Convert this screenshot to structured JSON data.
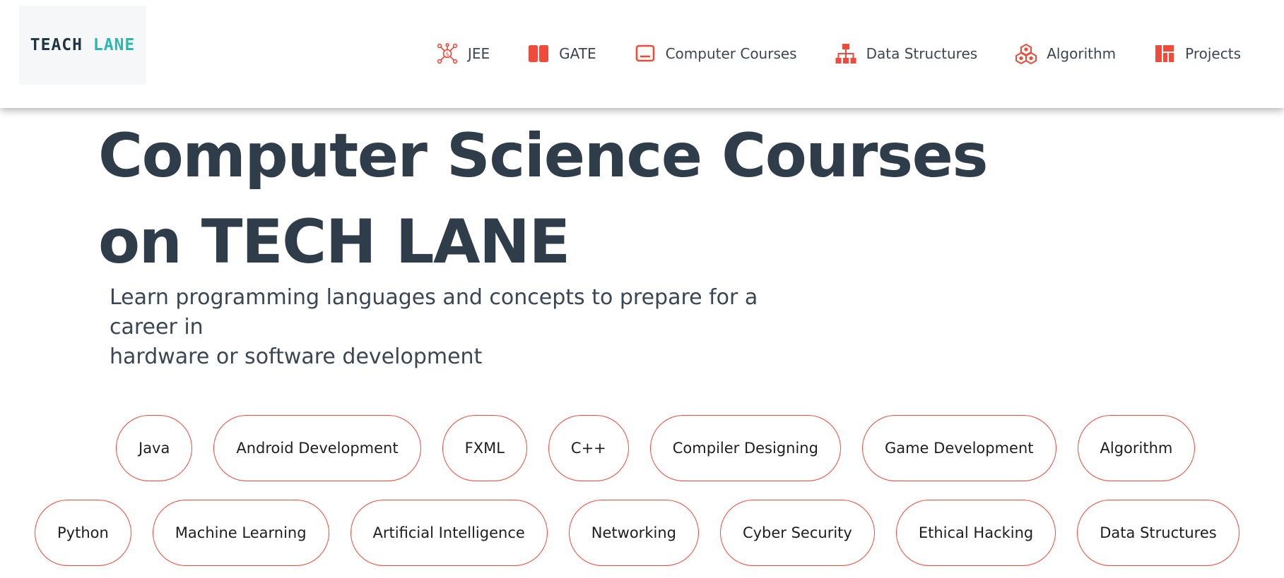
{
  "brand": {
    "logo_part1": "TEACH ",
    "logo_part2": "LANE"
  },
  "nav": {
    "items": [
      {
        "label": "JEE",
        "icon": "network-dollar-icon"
      },
      {
        "label": "GATE",
        "icon": "book-icon"
      },
      {
        "label": "Computer Courses",
        "icon": "laptop-icon"
      },
      {
        "label": "Data Structures",
        "icon": "hierarchy-icon"
      },
      {
        "label": "Algorithm",
        "icon": "cubes-icon"
      },
      {
        "label": "Projects",
        "icon": "layout-icon"
      }
    ]
  },
  "hero": {
    "title_line1": "Computer Science Courses",
    "title_line2": "on TECH LANE",
    "subtitle_line1": "Learn programming languages and concepts to prepare for a career in",
    "subtitle_line2": "hardware or software development"
  },
  "topics": {
    "row1": [
      "Java",
      "Android Development",
      "FXML",
      "C++",
      "Compiler Designing",
      "Game Development",
      "Algorithm"
    ],
    "row2": [
      "Python",
      "Machine Learning",
      "Artificial Intelligence",
      "Networking",
      "Cyber Security",
      "Ethical Hacking",
      "Data Structures"
    ]
  },
  "colors": {
    "accent": "#f04a3a",
    "heading": "#2f3d4b",
    "logo_teal": "#2bb8b0",
    "logo_dark": "#1f3642"
  }
}
